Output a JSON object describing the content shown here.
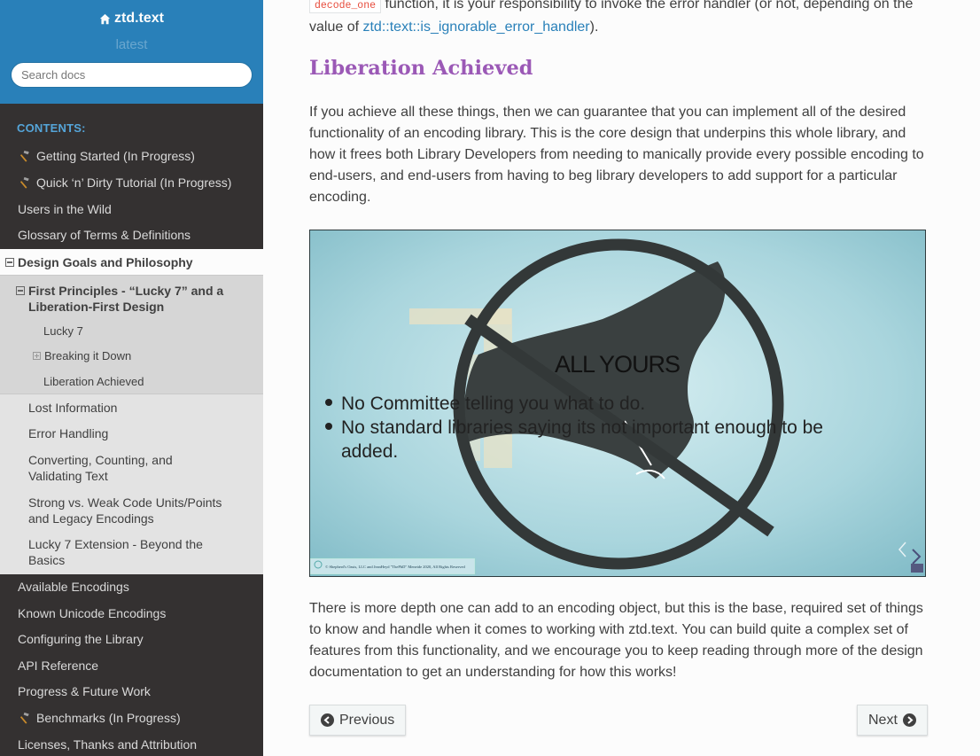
{
  "sidebar": {
    "brand": "ztd.text",
    "version": "latest",
    "search_placeholder": "Search docs",
    "caption": "CONTENTS:",
    "items_top": [
      {
        "label": "Getting Started (In Progress)",
        "icon": "hammer-icon"
      },
      {
        "label": "Quick ‘n’ Dirty Tutorial (In Progress)",
        "icon": "hammer-icon"
      },
      {
        "label": "Users in the Wild"
      },
      {
        "label": "Glossary of Terms & Definitions"
      }
    ],
    "current": {
      "label": "Design Goals and Philosophy",
      "sub_current_line1": "First Principles - “Lucky 7” and a",
      "sub_current_line2": "Liberation-First Design",
      "sub_items": [
        "Lucky 7",
        "Breaking it Down",
        "Liberation Achieved"
      ],
      "siblings": [
        {
          "line1": "Lost Information"
        },
        {
          "line1": "Error Handling"
        },
        {
          "line1": "Converting, Counting, and",
          "line2": "Validating Text"
        },
        {
          "line1": "Strong vs. Weak Code Units/Points",
          "line2": "and Legacy Encodings"
        },
        {
          "line1": "Lucky 7 Extension - Beyond the",
          "line2": "Basics"
        }
      ]
    },
    "items_bottom": [
      {
        "label": "Available Encodings"
      },
      {
        "label": "Known Unicode Encodings"
      },
      {
        "label": "Configuring the Library"
      },
      {
        "label": "API Reference"
      },
      {
        "label": "Progress & Future Work"
      },
      {
        "label": "Benchmarks (In Progress)",
        "icon": "hammer-icon"
      },
      {
        "label": "Licenses, Thanks and Attribution"
      }
    ]
  },
  "main": {
    "top_code": "decode_one",
    "top_text_a": " function, it is your responsibility to invoke the error handler (or not, depending on the",
    "top_text_b": "value of ",
    "top_link": "ztd::text::is_ignorable_error_handler",
    "top_text_c": ").",
    "heading": "Liberation Achieved",
    "para1": "If you achieve all these things, then we can guarantee that you can implement all of the desired functionality of an encoding library. This is the core design that underpins this whole library, and how it frees both Library Developers from needing to manically provide every possible encoding to end-users, and end-users from having to beg library developers to add support for a particular encoding.",
    "slide": {
      "title": "ALL YOURS",
      "bullet1": "No Committee telling you what to do.",
      "bullet2_line1": "No standard libraries saying its not important enough to be",
      "bullet2_line2": "added.",
      "footer": "© Shepherd's Oasis, LLC and JeanHeyd \"ThePhD\" Meneide 2020, All Rights Reserved"
    },
    "para2": "There is more depth one can add to an encoding object, but this is the base, required set of things to know and handle when it comes to working with ztd.text. You can build quite a complex set of features from this functionality, and we encourage you to keep reading through more of the design documentation to get an understanding for how this works!",
    "prev_label": "Previous",
    "next_label": "Next"
  },
  "colors": {
    "sidebar_bg": "#343131",
    "brand_bg": "#2980b9",
    "heading": "#9b59b6",
    "link": "#2980b9",
    "caption": "#55a5d9"
  }
}
